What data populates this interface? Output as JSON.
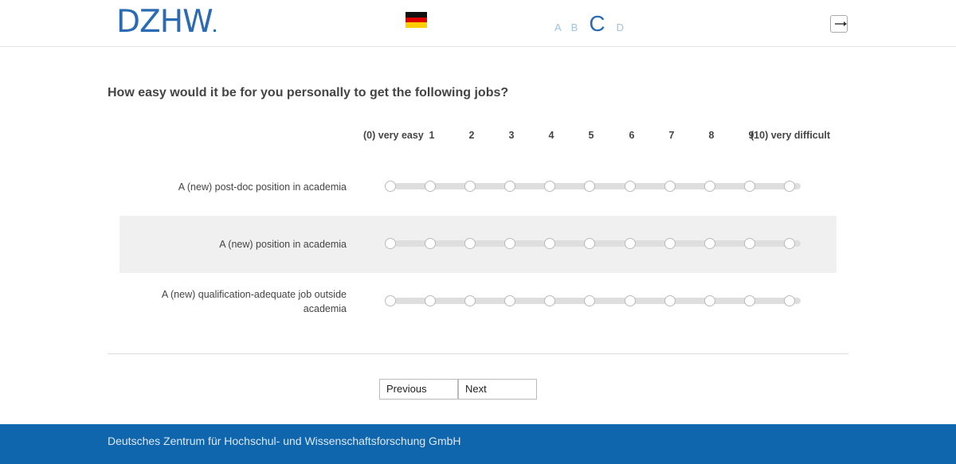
{
  "header": {
    "logo_text": "DZHW",
    "language_flag": "german-flag-icon",
    "font_size_options": [
      "A",
      "B",
      "C",
      "D"
    ],
    "font_size_active": "C",
    "logout_icon": "logout-icon"
  },
  "question": {
    "title": "How easy would it be for you personally to get the following jobs?",
    "scale_labels": [
      "(0) very easy",
      "1",
      "2",
      "3",
      "4",
      "5",
      "6",
      "7",
      "8",
      "9",
      "(10) very difficult"
    ],
    "items": [
      {
        "label": "A (new) post-doc position in academia"
      },
      {
        "label": "A (new) position in academia"
      },
      {
        "label": "A (new) qualification-adequate job outside academia"
      }
    ]
  },
  "nav": {
    "previous_label": "Previous",
    "next_label": "Next"
  },
  "footer": {
    "text": "Deutsches Zentrum für Hochschul- und Wissenschaftsforschung GmbH"
  },
  "colors": {
    "brand_blue": "#2a6bb3",
    "footer_blue": "#0f66ad",
    "row_shade": "#f0f0f0",
    "track": "#dedede"
  }
}
